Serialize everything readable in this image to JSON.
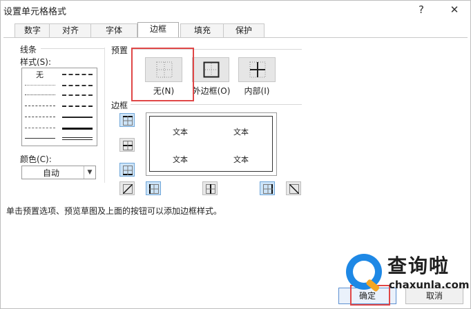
{
  "window": {
    "title": "设置单元格格式",
    "help_label": "?",
    "close_label": "✕"
  },
  "tabs": [
    {
      "label": "数字",
      "active": false
    },
    {
      "label": "对齐",
      "active": false
    },
    {
      "label": "字体",
      "active": false
    },
    {
      "label": "边框",
      "active": true
    },
    {
      "label": "填充",
      "active": false
    },
    {
      "label": "保护",
      "active": false
    }
  ],
  "line": {
    "group_label": "线条",
    "style_label": "样式(S):",
    "styles": [
      "无"
    ],
    "color_label": "颜色(C):",
    "color_value": "自动"
  },
  "presets": {
    "group_label": "预置",
    "buttons": [
      {
        "label": "无(N)",
        "icon": "border-none-icon",
        "highlighted": true
      },
      {
        "label": "外边框(O)",
        "icon": "border-outline-icon"
      },
      {
        "label": "内部(I)",
        "icon": "border-inside-icon"
      }
    ]
  },
  "border": {
    "group_label": "边框",
    "preview_texts": [
      "文本",
      "文本",
      "文本",
      "文本"
    ]
  },
  "hint": "单击预置选项、预览草图及上面的按钮可以添加边框样式。",
  "footer": {
    "ok_label": "确定",
    "cancel_label": "取消"
  },
  "watermark": {
    "text": "查询啦",
    "sub": "chaxunla.com"
  },
  "colors": {
    "accent_red": "#e04646",
    "active_blue": "#cde4f8",
    "brand_blue": "#1e88e5",
    "brand_orange": "#f5a623"
  }
}
